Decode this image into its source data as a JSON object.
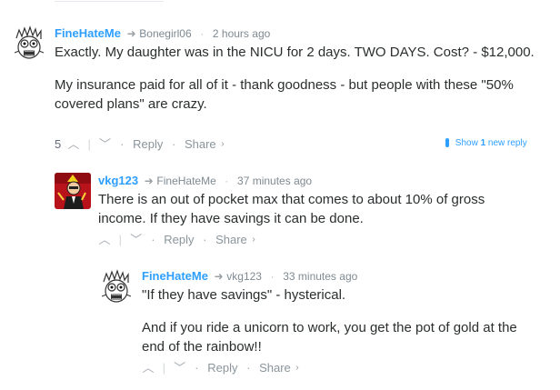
{
  "comments": [
    {
      "author": "FineHateMe",
      "parent_author": "Bonegirl06",
      "time": "2 hours ago",
      "paragraphs": [
        "Exactly. My daughter was in the NICU for 2 days. TWO DAYS. Cost? - $12,000.",
        "My insurance paid for all of it - thank goodness - but people with these \"50% covered plans\" are crazy."
      ],
      "vote_count": "5",
      "reply_label": "Reply",
      "share_label": "Share",
      "new_replies": {
        "show": "Show",
        "count": "1",
        "text": "new reply"
      }
    },
    {
      "author": "vkg123",
      "parent_author": "FineHateMe",
      "time": "37 minutes ago",
      "paragraphs": [
        "There is an out of pocket max that comes to about 10% of gross income. If they have savings it can be done."
      ],
      "reply_label": "Reply",
      "share_label": "Share"
    },
    {
      "author": "FineHateMe",
      "parent_author": "vkg123",
      "time": "33 minutes ago",
      "paragraphs": [
        "\"If they have savings\" - hysterical.",
        "And if you ride a unicorn to work, you get the pot of gold at the end of the rainbow!!"
      ],
      "reply_label": "Reply",
      "share_label": "Share"
    }
  ],
  "colors": {
    "author": "#2e9fff",
    "meta": "#7f8a92",
    "text": "#2a2e2e",
    "accent": "#2e9fff"
  },
  "icons": {
    "arrow": "reply-arrow-icon",
    "upvote": "chevron-up-icon",
    "downvote": "chevron-down-icon",
    "share_more": "chevron-right-icon"
  }
}
